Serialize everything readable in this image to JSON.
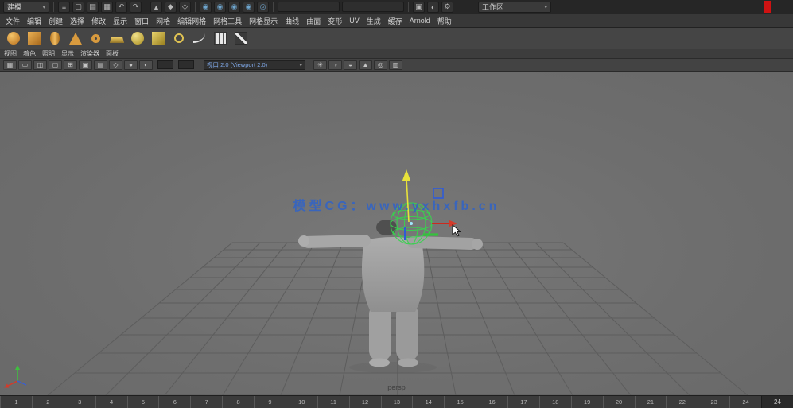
{
  "status_bar": {
    "menuset_label": "建模",
    "workspace_label": "工作区",
    "left_icons": [
      {
        "name": "hamburger-menu-icon",
        "glyph": "≡"
      },
      {
        "name": "new-scene-icon",
        "glyph": "▢"
      },
      {
        "name": "open-scene-icon",
        "glyph": "▤"
      },
      {
        "name": "save-scene-icon",
        "glyph": "▦"
      },
      {
        "name": "undo-icon",
        "glyph": "↶"
      },
      {
        "name": "redo-icon",
        "glyph": "↷"
      }
    ],
    "mask_icons": [
      {
        "name": "select-hierarchy-icon",
        "glyph": "▲"
      },
      {
        "name": "select-object-icon",
        "glyph": "◆"
      },
      {
        "name": "select-component-icon",
        "glyph": "◇"
      }
    ],
    "snap_icons": [
      {
        "name": "snap-to-grid-icon",
        "glyph": "◉"
      },
      {
        "name": "snap-to-curve-icon",
        "glyph": "◉"
      },
      {
        "name": "snap-to-point-icon",
        "glyph": "◉"
      },
      {
        "name": "snap-to-plane-icon",
        "glyph": "◉"
      },
      {
        "name": "make-live-icon",
        "glyph": "◎"
      }
    ],
    "render_icons": [
      {
        "name": "render-view-icon",
        "glyph": "▣"
      },
      {
        "name": "ipr-render-icon",
        "glyph": "◐"
      },
      {
        "name": "render-settings-icon",
        "glyph": "⚙"
      }
    ]
  },
  "menu_bar": {
    "items": [
      "文件",
      "编辑",
      "创建",
      "选择",
      "修改",
      "显示",
      "窗口",
      "网格",
      "编辑网格",
      "网格工具",
      "网格显示",
      "曲线",
      "曲面",
      "变形",
      "UV",
      "生成",
      "缓存",
      "Arnold",
      "帮助"
    ]
  },
  "shelf": {
    "icons": [
      {
        "name": "poly-sphere-icon",
        "shape": "shape-sphere"
      },
      {
        "name": "poly-cube-icon",
        "shape": "shape-cube"
      },
      {
        "name": "poly-cylinder-icon",
        "shape": "shape-cylinder"
      },
      {
        "name": "poly-cone-icon",
        "shape": "shape-cone"
      },
      {
        "name": "poly-torus-icon",
        "shape": "shape-torus"
      },
      {
        "name": "poly-plane-icon",
        "shape": "shape-plane"
      },
      {
        "name": "nurbs-sphere-icon",
        "shape": "shape-nsphere"
      },
      {
        "name": "nurbs-cube-icon",
        "shape": "shape-ncube"
      },
      {
        "name": "nurbs-circle-icon",
        "shape": "shape-ncircle"
      },
      {
        "name": "ep-curve-tool-icon",
        "shape": "shape-curve"
      },
      {
        "name": "quad-draw-icon",
        "shape": "shape-grid"
      },
      {
        "name": "multi-cut-icon",
        "shape": "shape-pen"
      }
    ]
  },
  "panel": {
    "menus": [
      "视图",
      "着色",
      "照明",
      "显示",
      "渲染器",
      "面板"
    ],
    "icons": [
      {
        "name": "grid-toggle-icon",
        "glyph": "▦"
      },
      {
        "name": "film-gate-icon",
        "glyph": "▭"
      },
      {
        "name": "resolution-gate-icon",
        "glyph": "◫"
      },
      {
        "name": "gate-mask-icon",
        "glyph": "▢"
      },
      {
        "name": "field-chart-icon",
        "glyph": "⊞"
      },
      {
        "name": "safe-action-icon",
        "glyph": "▣"
      },
      {
        "name": "safe-title-icon",
        "glyph": "▤"
      },
      {
        "name": "wireframe-icon",
        "glyph": "◇"
      },
      {
        "name": "shaded-icon",
        "glyph": "●"
      },
      {
        "name": "textured-icon",
        "glyph": "◐"
      }
    ],
    "icons_right": [
      {
        "name": "lighting-icon",
        "glyph": "☀"
      },
      {
        "name": "shadows-icon",
        "glyph": "◑"
      },
      {
        "name": "screen-space-ao-icon",
        "glyph": "◒"
      },
      {
        "name": "anti-alias-icon",
        "glyph": "▲"
      },
      {
        "name": "isolate-select-icon",
        "glyph": "◎"
      },
      {
        "name": "xray-icon",
        "glyph": "▥"
      }
    ],
    "renderer_label": "视口 2.0 (Viewport 2.0)",
    "camera_label": "persp"
  },
  "viewport": {
    "watermark": "模型CG：www.yxhxfb.cn"
  },
  "timeline": {
    "ticks": [
      "1",
      "2",
      "3",
      "4",
      "5",
      "6",
      "7",
      "8",
      "9",
      "10",
      "11",
      "12",
      "13",
      "14",
      "15",
      "16",
      "17",
      "18",
      "19",
      "20",
      "21",
      "22",
      "23",
      "24"
    ],
    "end_frame": "24"
  },
  "colors": {
    "accent_blue": "#2f63c9",
    "manipulator_green": "#39d24f",
    "axis_yellow": "#e8e23a",
    "axis_red": "#d43a2a",
    "axis_blue": "#2f5bd8"
  }
}
